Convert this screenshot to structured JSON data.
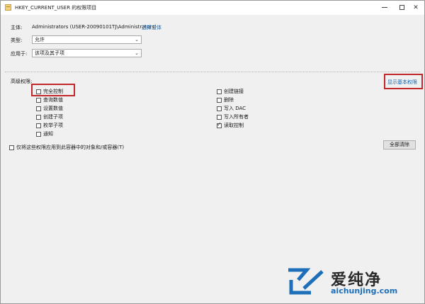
{
  "window": {
    "title": "HKEY_CURRENT_USER 的权限项目"
  },
  "header": {
    "principal_label": "主体:",
    "principal_value": "Administrators (USER-20090101TJ\\Administrators)",
    "select_principal_link": "选择主体",
    "type_label": "类型:",
    "type_value": "允许",
    "applies_label": "应用于:",
    "applies_value": "该项及其子项"
  },
  "advanced": {
    "section_label": "高级权限:",
    "show_basic_link": "显示基本权限",
    "left_permissions": [
      {
        "label": "完全控制",
        "checked": false
      },
      {
        "label": "查询数值",
        "checked": false
      },
      {
        "label": "设置数值",
        "checked": false
      },
      {
        "label": "创建子项",
        "checked": false
      },
      {
        "label": "枚举子项",
        "checked": false
      },
      {
        "label": "通知",
        "checked": false
      }
    ],
    "right_permissions": [
      {
        "label": "创建链接",
        "checked": false
      },
      {
        "label": "删除",
        "checked": false
      },
      {
        "label": "写入 DAC",
        "checked": false
      },
      {
        "label": "写入所有者",
        "checked": false
      },
      {
        "label": "读取控制",
        "checked": true
      }
    ],
    "apply_only_label": "仅将这些权限应用到此容器中的对象和/或容器(T)",
    "clear_all_button": "全部清除"
  },
  "watermark": {
    "brand_cn": "爱纯净",
    "brand_url": "aichunjing.com"
  }
}
